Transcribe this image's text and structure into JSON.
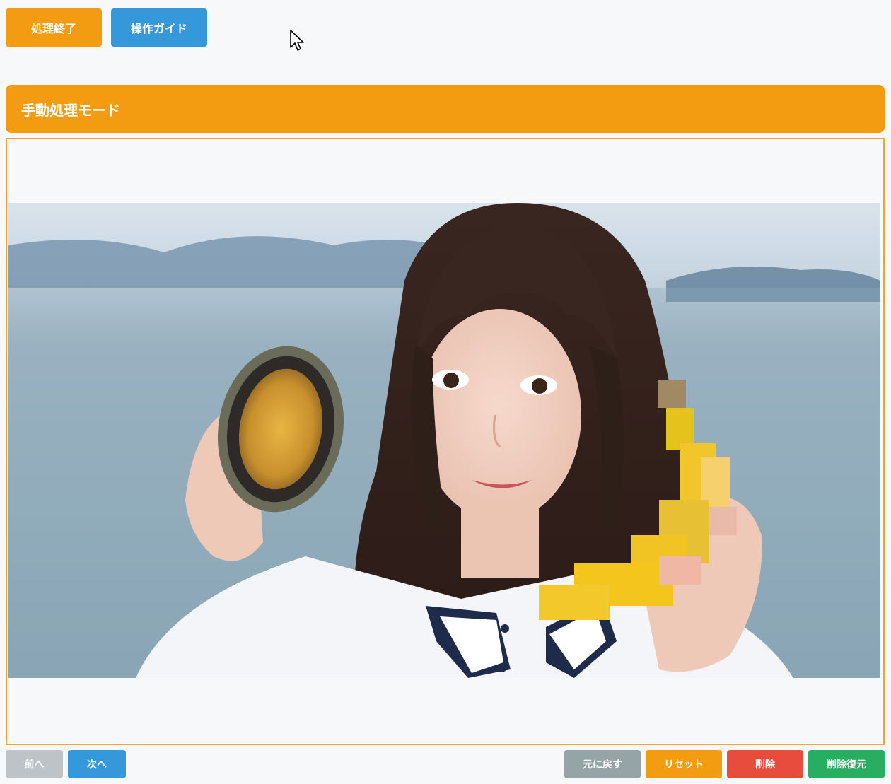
{
  "toolbar": {
    "finish_label": "処理終了",
    "guide_label": "操作ガイド"
  },
  "header": {
    "title": "手動処理モード"
  },
  "navigation": {
    "prev_label": "前へ",
    "next_label": "次へ"
  },
  "actions": {
    "undo_label": "元に戻す",
    "reset_label": "リセット",
    "delete_label": "削除",
    "restore_label": "削除復元"
  },
  "colors": {
    "accent_orange": "#f39c12",
    "primary_blue": "#3498db",
    "disabled_gray": "#bdc3c7",
    "undo_gray": "#95a5a6",
    "danger_red": "#e74c3c",
    "success_green": "#27ae60",
    "frame_border": "#f0a233"
  },
  "icons": {
    "cursor": "mouse-pointer-icon"
  }
}
